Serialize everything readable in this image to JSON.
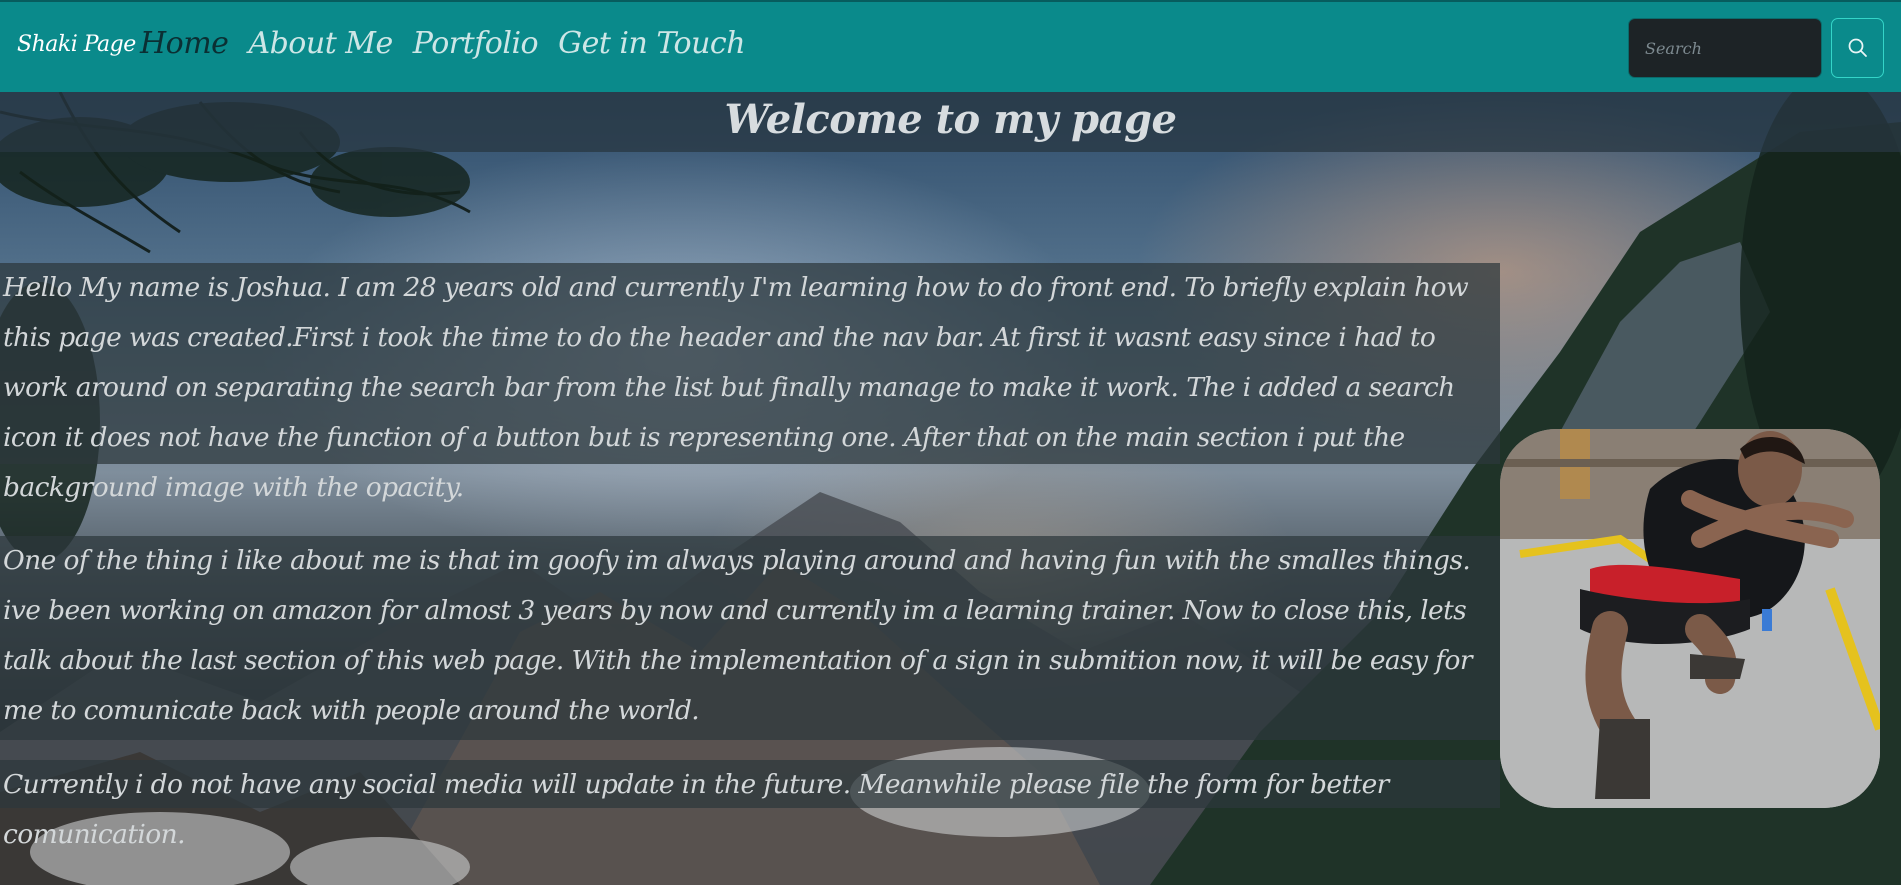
{
  "navbar": {
    "brand": "Shaki Page",
    "links": [
      "Home",
      "About Me",
      "Portfolio",
      "Get in Touch"
    ],
    "active": "Home",
    "search_placeholder": "Search",
    "search_icon": "search-icon",
    "background_color": "#0a8a8b"
  },
  "main": {
    "title": "Welcome to my page",
    "paragraphs": [
      "Hello My name is Joshua. I am 28 years old and currently I'm learning how to do front end. To briefly explain how this page was created.First i took the time to do the header and the nav bar. At first it wasnt easy since i had to work around on separating the search bar from the list but finally manage to make it work. The i added a search icon it does not have the function of a button but is representing one. After that on the main section i put the background image with the opacity.",
      "One of the thing i like about me is that im goofy im always playing around and having fun with the smalles things. ive been working on amazon for almost 3 years by now and currently im a learning trainer. Now to close this, lets talk about the last section of this web page. With the implementation of a sign in submition now, it will be easy for me to comunicate back with people around the world.",
      "Currently i do not have any social media will update in the future. Meanwhile please file the form for better comunication."
    ],
    "profile_photo": "profile-photo"
  }
}
